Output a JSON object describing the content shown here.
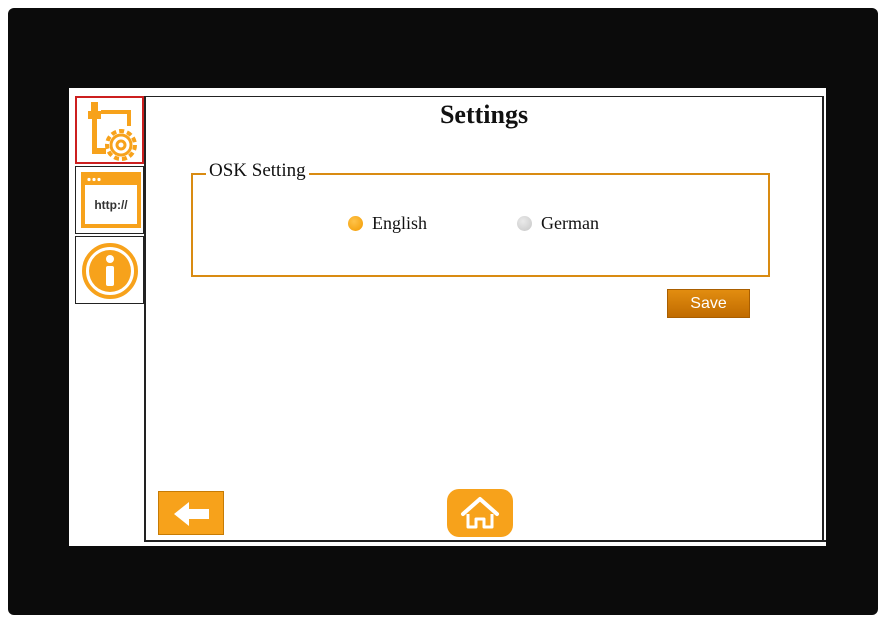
{
  "page": {
    "title": "Settings"
  },
  "sidebar": {
    "items": [
      {
        "name": "settings",
        "icon": "plug-gear-icon",
        "active": true
      },
      {
        "name": "http",
        "icon": "http-window-icon",
        "label": "http://",
        "active": false
      },
      {
        "name": "info",
        "icon": "info-icon",
        "active": false
      }
    ]
  },
  "osk": {
    "legend": "OSK Setting",
    "options": [
      {
        "label": "English",
        "selected": true
      },
      {
        "label": "German",
        "selected": false
      }
    ]
  },
  "actions": {
    "save_label": "Save"
  },
  "nav": {
    "back_icon": "arrow-left-icon",
    "home_icon": "home-icon"
  },
  "colors": {
    "accent": "#F7A21B",
    "active_border": "#CC1F1F",
    "fieldset_border": "#D98B12"
  }
}
